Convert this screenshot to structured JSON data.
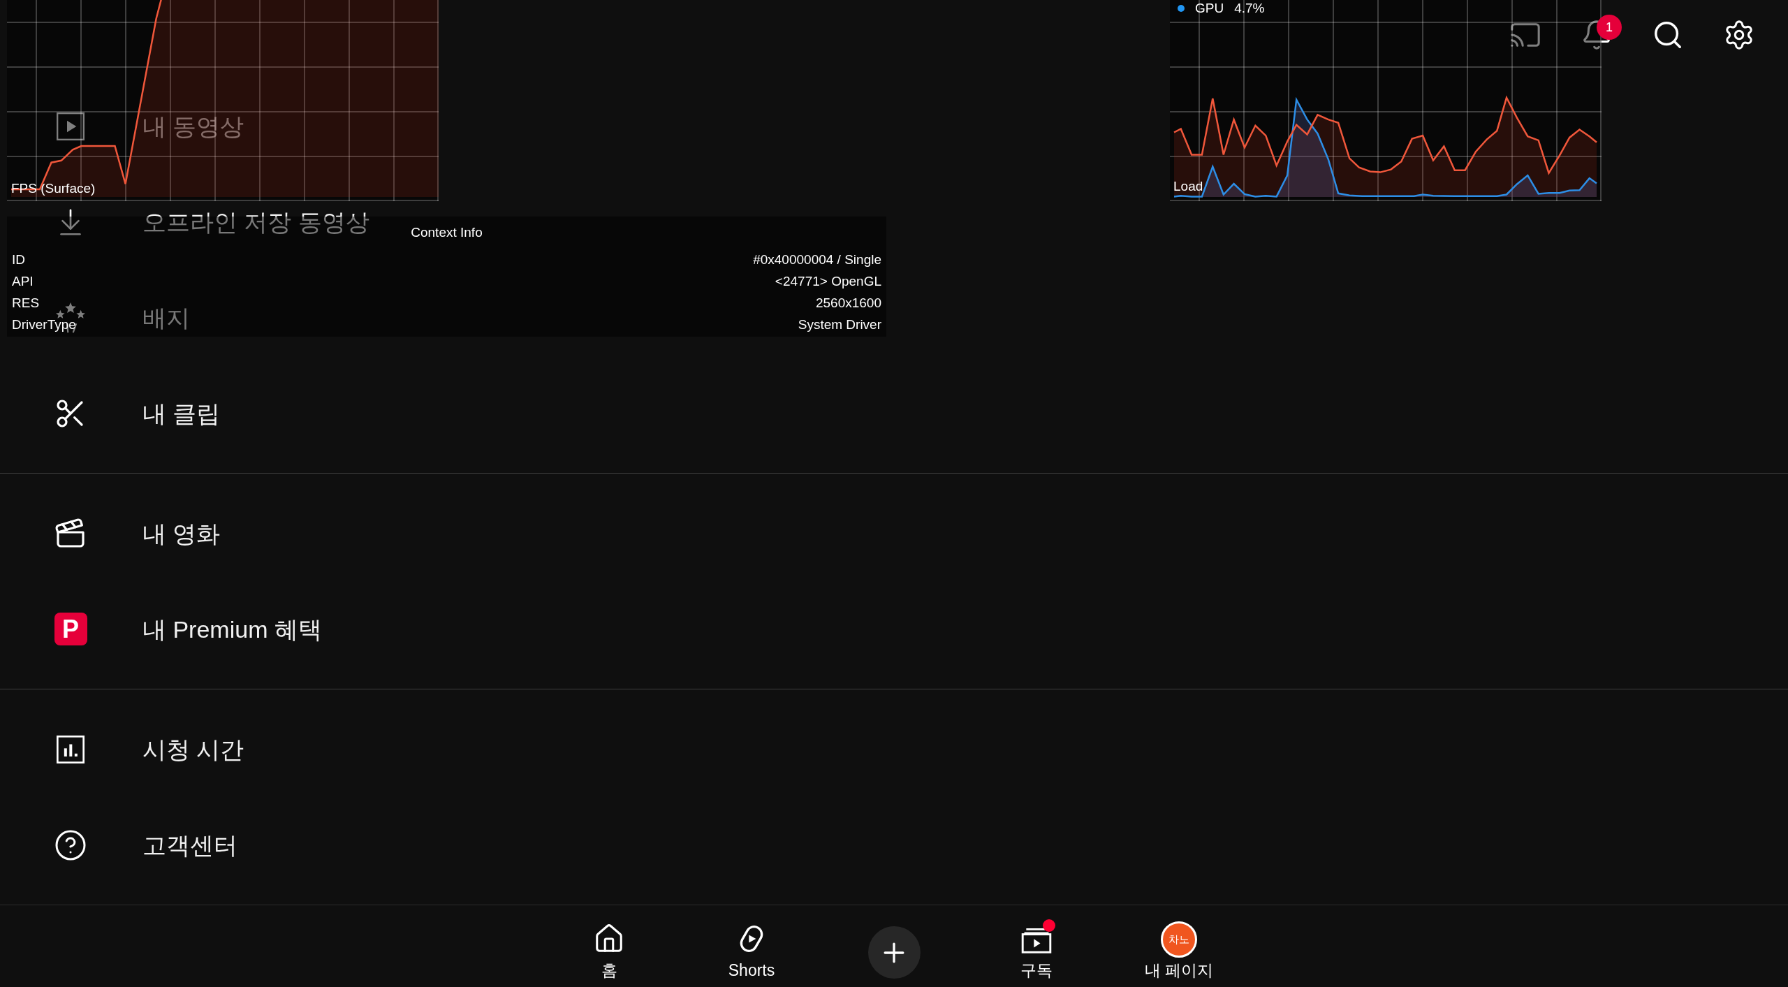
{
  "top_bar": {
    "notification_badge": "1"
  },
  "menu": {
    "sections": [
      {
        "items": [
          {
            "label": "내 동영상"
          },
          {
            "label": "오프라인 저장 동영상"
          },
          {
            "label": "배지"
          },
          {
            "label": "내 클립"
          }
        ]
      },
      {
        "items": [
          {
            "label": "내 영화"
          },
          {
            "label": "내 Premium 혜택",
            "logo": "P"
          }
        ]
      },
      {
        "items": [
          {
            "label": "시청 시간"
          },
          {
            "label": "고객센터"
          }
        ]
      }
    ]
  },
  "fps_overlay": {
    "label": "FPS (Surface)"
  },
  "gpu_overlay": {
    "legend_name": "GPU",
    "legend_value": "4.7%",
    "label": "Load"
  },
  "context_info": {
    "title": "Context Info",
    "rows": [
      {
        "key": "ID",
        "value": "#0x40000004 / Single"
      },
      {
        "key": "API",
        "value": "<24771> OpenGL"
      },
      {
        "key": "RES",
        "value": "2560x1600"
      },
      {
        "key": "DriverType",
        "value": "System Driver"
      }
    ]
  },
  "bottom_nav": {
    "items": [
      {
        "kind": "tab",
        "label": "홈"
      },
      {
        "kind": "tab",
        "label": "Shorts"
      },
      {
        "kind": "create"
      },
      {
        "kind": "tab",
        "label": "구독",
        "new_content": true
      },
      {
        "kind": "profile",
        "label": "내 페이지",
        "avatar": "차노"
      }
    ]
  }
}
